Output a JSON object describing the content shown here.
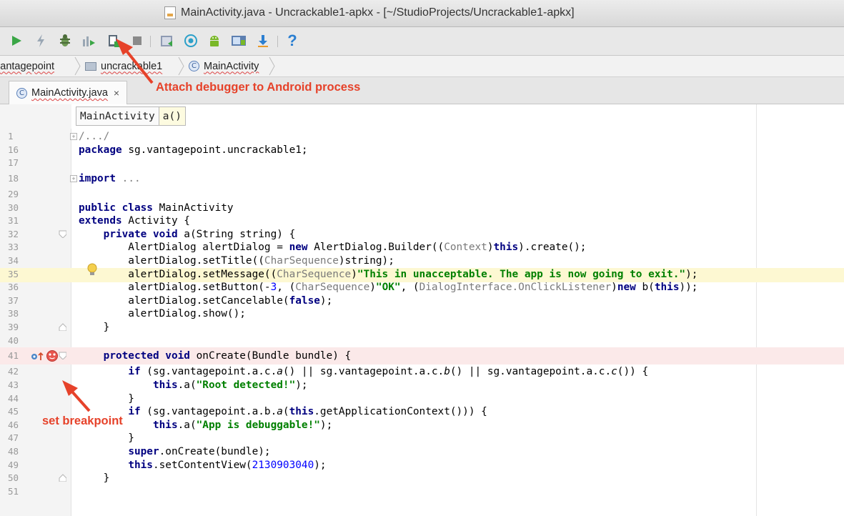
{
  "window": {
    "title": "MainActivity.java - Uncrackable1-apkx - [~/StudioProjects/Uncrackable1-apkx]"
  },
  "toolbar": {
    "icons": [
      "run-icon",
      "lightning-icon",
      "debug-icon",
      "profile-icon",
      "attach-debugger-icon",
      "stop-icon",
      "sync-icon",
      "android-monitor-icon",
      "sdk-manager-icon",
      "avd-manager-icon",
      "download-icon",
      "help-icon"
    ],
    "help_label": "?"
  },
  "nav": {
    "crumbs": [
      "vantagepoint",
      "uncrackable1",
      "MainActivity"
    ]
  },
  "tab": {
    "label": "MainActivity.java",
    "close": "×"
  },
  "annotations": {
    "debugger": "Attach debugger to Android process",
    "breakpoint": "set breakpoint"
  },
  "editor": {
    "breadcrumb_class": "MainActivity",
    "breadcrumb_method": "a()",
    "line_numbers": [
      "1",
      "16",
      "17",
      "18",
      "29",
      "30",
      "31",
      "32",
      "33",
      "34",
      "35",
      "36",
      "37",
      "38",
      "39",
      "40",
      "41",
      "42",
      "43",
      "44",
      "45",
      "46",
      "47",
      "48",
      "49",
      "50",
      "51"
    ]
  },
  "colors": {
    "callout": "#e6422a",
    "keyword": "#000080",
    "string": "#008000",
    "number": "#0000ff"
  }
}
